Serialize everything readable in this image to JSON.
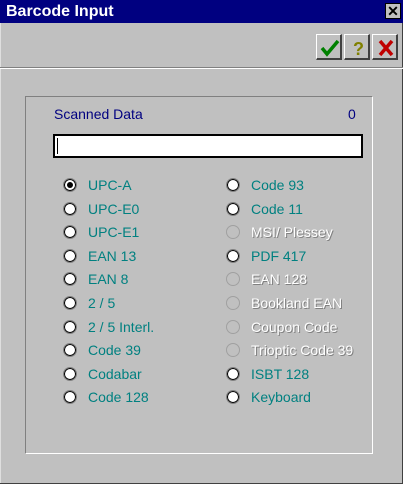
{
  "window": {
    "title": "Barcode Input"
  },
  "toolbar": {
    "ok_icon": "checkmark-icon",
    "help_icon": "question-mark-icon",
    "cancel_icon": "x-icon"
  },
  "scan": {
    "label": "Scanned Data",
    "count": "0",
    "value": ""
  },
  "options_left": [
    {
      "label": "UPC-A",
      "selected": true,
      "enabled": true
    },
    {
      "label": "UPC-E0",
      "selected": false,
      "enabled": true
    },
    {
      "label": "UPC-E1",
      "selected": false,
      "enabled": true
    },
    {
      "label": "EAN 13",
      "selected": false,
      "enabled": true
    },
    {
      "label": "EAN 8",
      "selected": false,
      "enabled": true
    },
    {
      "label": "2 / 5",
      "selected": false,
      "enabled": true
    },
    {
      "label": "2 / 5 Interl.",
      "selected": false,
      "enabled": true
    },
    {
      "label": "Code 39",
      "selected": false,
      "enabled": true
    },
    {
      "label": "Codabar",
      "selected": false,
      "enabled": true
    },
    {
      "label": "Code 128",
      "selected": false,
      "enabled": true
    }
  ],
  "options_right": [
    {
      "label": "Code 93",
      "selected": false,
      "enabled": true
    },
    {
      "label": "Code 11",
      "selected": false,
      "enabled": true
    },
    {
      "label": "MSI/ Plessey",
      "selected": false,
      "enabled": false
    },
    {
      "label": "PDF 417",
      "selected": false,
      "enabled": true
    },
    {
      "label": "EAN 128",
      "selected": false,
      "enabled": false
    },
    {
      "label": "Bookland EAN",
      "selected": false,
      "enabled": false
    },
    {
      "label": "Coupon Code",
      "selected": false,
      "enabled": false
    },
    {
      "label": "Trioptic Code 39",
      "selected": false,
      "enabled": false
    },
    {
      "label": "ISBT 128",
      "selected": false,
      "enabled": true
    },
    {
      "label": "Keyboard",
      "selected": false,
      "enabled": true
    }
  ],
  "colors": {
    "title_bg": "#000080",
    "label": "#008080",
    "dialog_bg": "#c0c0c0"
  }
}
